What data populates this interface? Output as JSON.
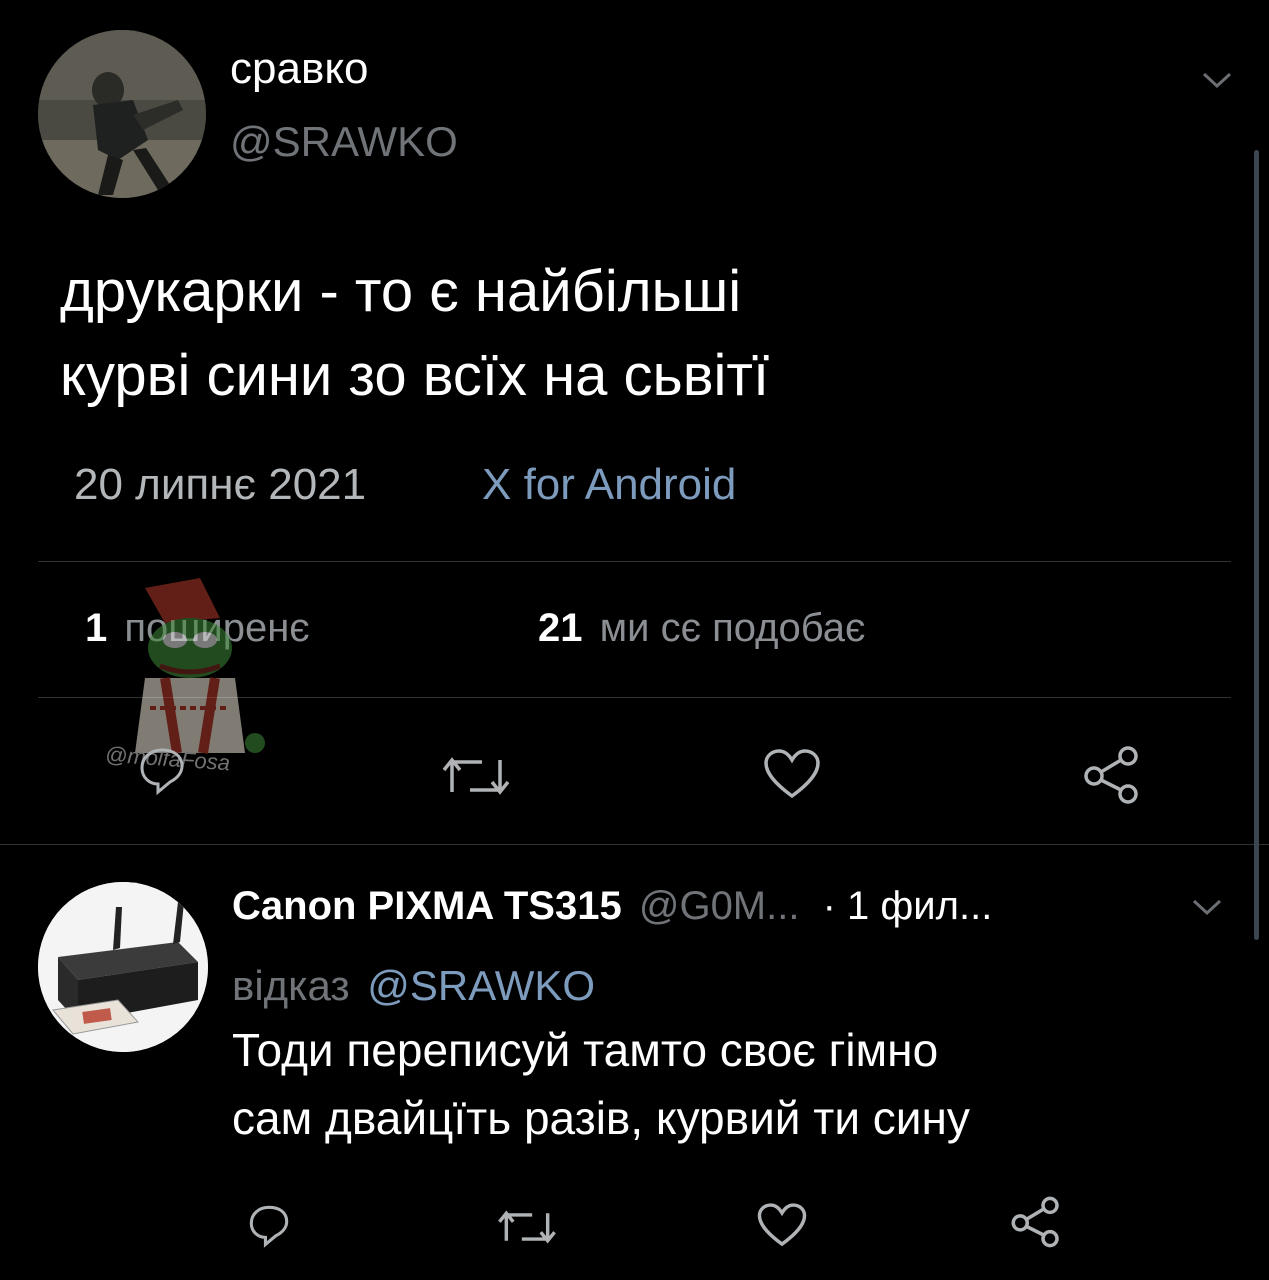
{
  "tweet": {
    "author_name": "сравко",
    "author_handle": "@SRAWKO",
    "text_line1": "друкарки - то є найбільші",
    "text_line2": "курві сини зо всїх на сьвітї",
    "date": "20 липнє 2021",
    "client": "X for Android",
    "retweets_count": "1",
    "retweets_label": "поширенє",
    "likes_count": "21",
    "likes_label": "ми сє подобає"
  },
  "watermark": {
    "text": "@molfaFosa"
  },
  "reply": {
    "author_name": "Canon PIXMA TS315",
    "author_handle": "@G0M...",
    "time": "· 1 фил...",
    "reply_prefix": "відказ",
    "reply_to": "@SRAWKO",
    "text_line1": "Тоди переписуй тамто своє гімно",
    "text_line2": "сам двайцїть разів, курвий ти сину"
  },
  "icons": {
    "tweet_menu": "chevron-down-icon",
    "reply": "speech-bubble-icon",
    "retweet": "retweet-icon",
    "like": "heart-icon",
    "share": "share-icon"
  },
  "colors": {
    "background": "#000000",
    "text_primary": "#ffffff",
    "text_secondary": "#707478",
    "link": "#7d9bbd",
    "divider": "#2f3336"
  }
}
